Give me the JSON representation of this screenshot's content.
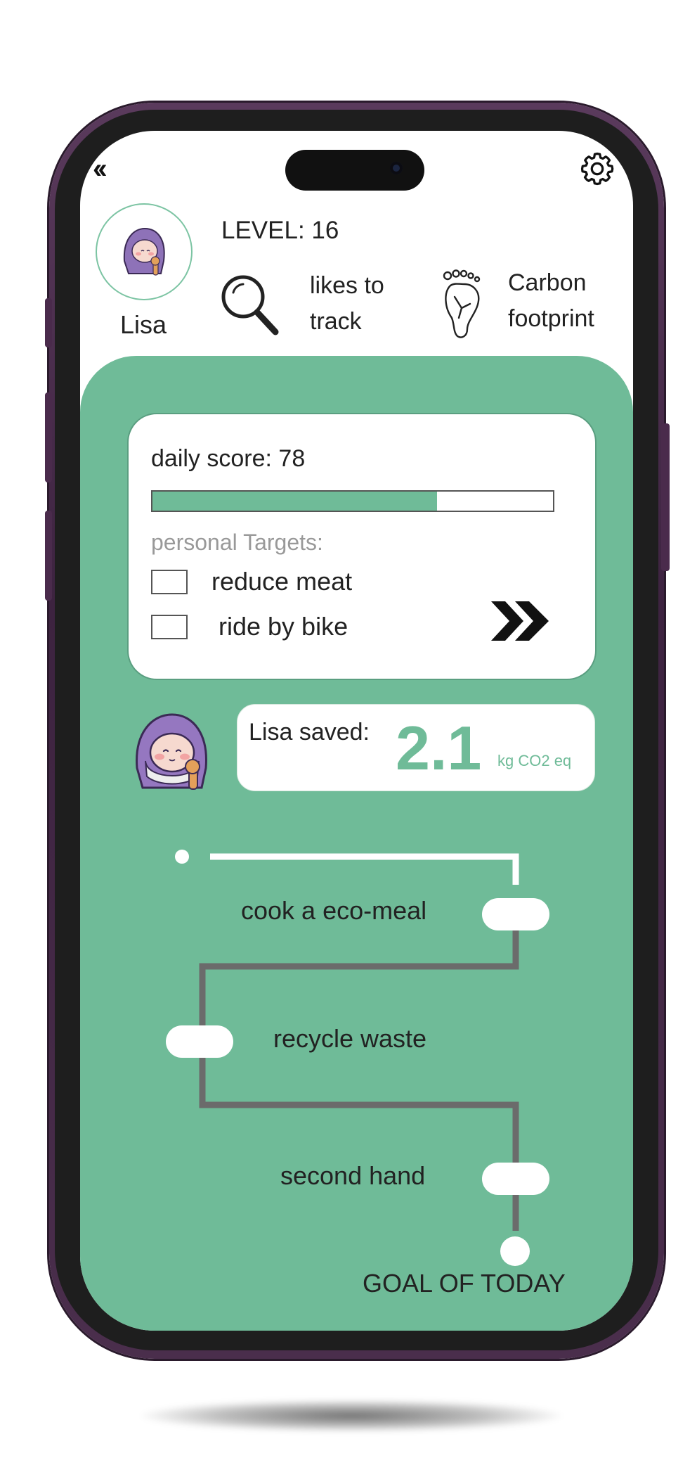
{
  "profile": {
    "name": "Lisa",
    "level_text": "LEVEL: 16",
    "likes_line1": "likes to",
    "likes_line2": "track",
    "carbon_line1": "Carbon",
    "carbon_line2": "footprint"
  },
  "icons": {
    "back": "back-chevrons-icon",
    "settings": "gear-icon",
    "likes": "magnifier-icon",
    "carbon": "footprint-icon",
    "forward": "forward-chevrons-icon"
  },
  "daily": {
    "score_text": "daily score: 78",
    "progress": 0.71,
    "targets_label": "personal Targets:",
    "targets": [
      {
        "label": "reduce meat",
        "checked": false
      },
      {
        "label": "ride by bike",
        "checked": false
      }
    ]
  },
  "saved": {
    "label": "Lisa saved:",
    "value": "2.1",
    "unit": "kg CO2 eq"
  },
  "path": {
    "steps": [
      "cook a eco-meal",
      "recycle waste",
      "second hand"
    ],
    "goal": "GOAL OF TODAY"
  },
  "colors": {
    "accent_green": "#6fbb98",
    "phone_frame": "#3d2340",
    "path_done": "#ffffff",
    "path_todo": "#6b6b6b"
  }
}
